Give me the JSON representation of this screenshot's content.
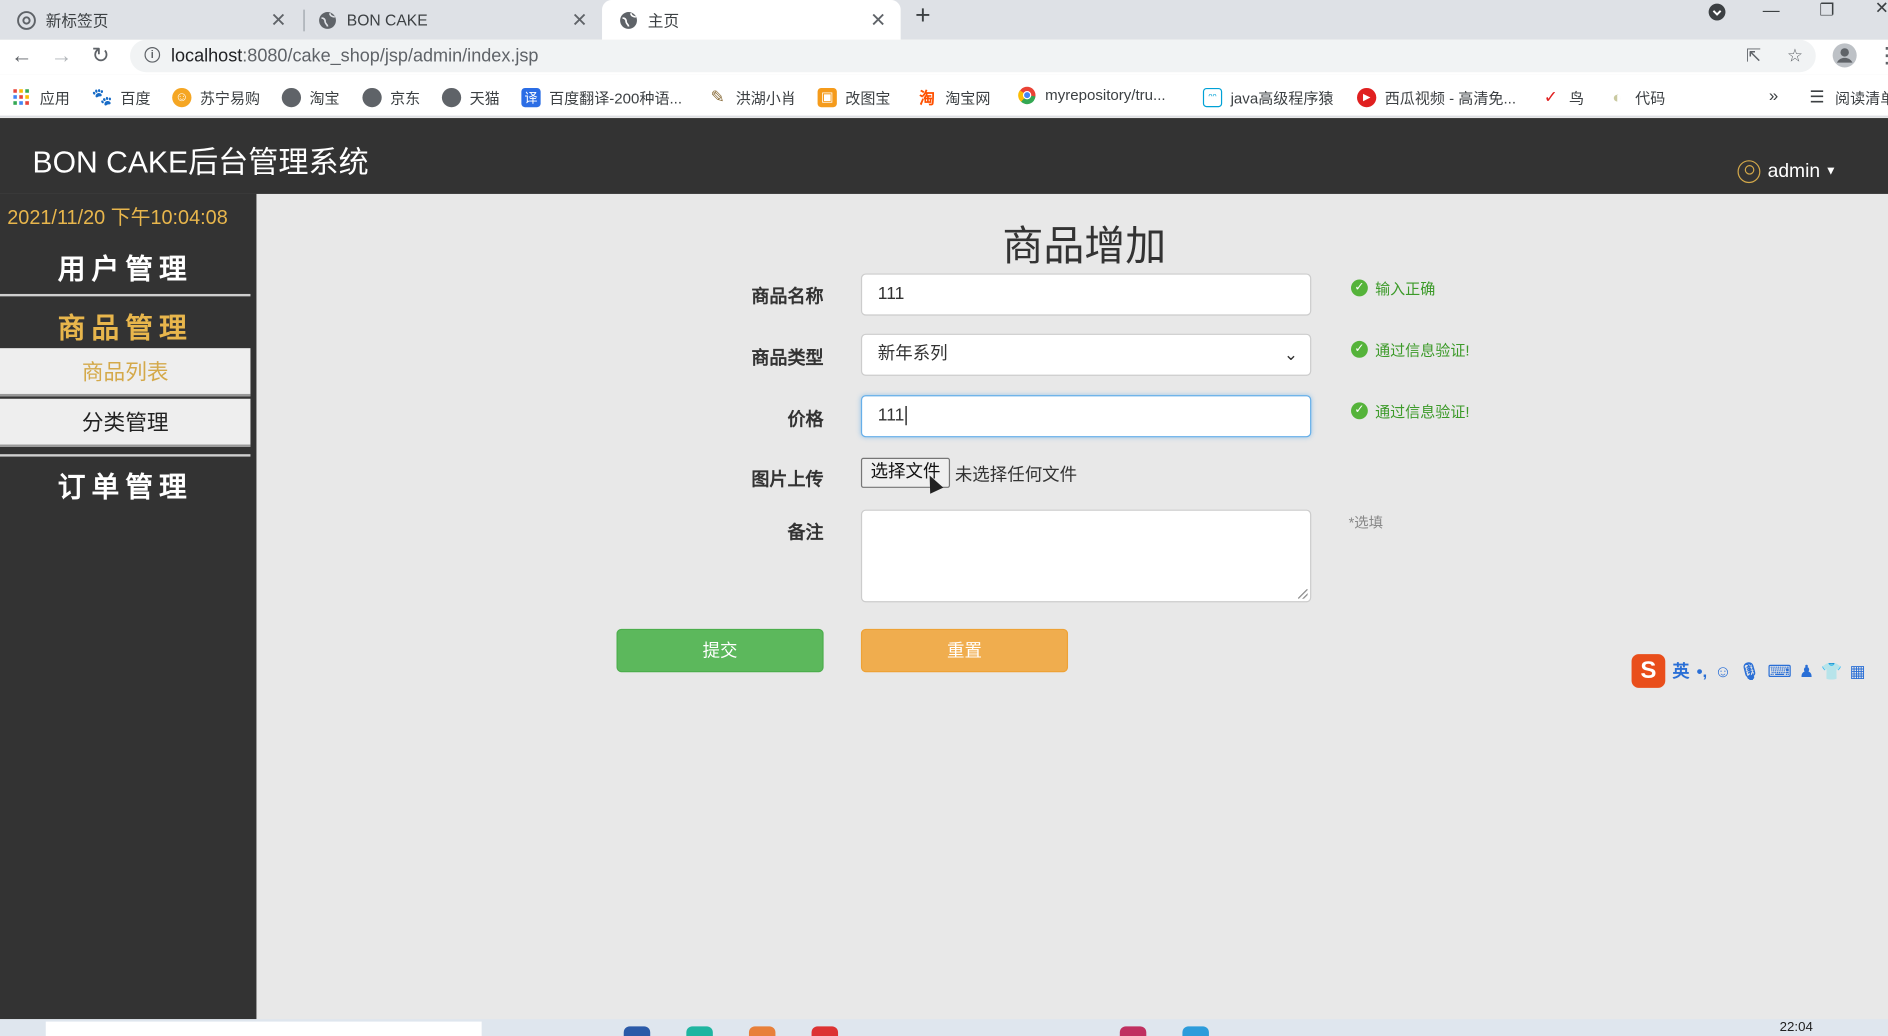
{
  "browser": {
    "tabs": [
      {
        "title": "新标签页",
        "icon": "chrome-icon",
        "active": false
      },
      {
        "title": "BON CAKE",
        "icon": "globe-icon",
        "active": false
      },
      {
        "title": "主页",
        "icon": "globe-icon",
        "active": true
      }
    ],
    "url_host": "localhost",
    "url_path": ":8080/cake_shop/jsp/admin/index.jsp",
    "bookmarks": [
      {
        "label": "应用",
        "icon": "apps-grid-icon",
        "color": "#e8453c"
      },
      {
        "label": "百度",
        "icon": "baidu-paw-icon",
        "color": "#2932e1"
      },
      {
        "label": "苏宁易购",
        "icon": "suning-icon",
        "color": "#f5a623"
      },
      {
        "label": "淘宝",
        "icon": "globe-icon",
        "color": "#5f6368"
      },
      {
        "label": "京东",
        "icon": "globe-icon",
        "color": "#5f6368"
      },
      {
        "label": "天猫",
        "icon": "globe-icon",
        "color": "#5f6368"
      },
      {
        "label": "百度翻译-200种语...",
        "icon": "translate-icon",
        "color": "#2b6de5"
      },
      {
        "label": "洪湖小肖",
        "icon": "feather-icon",
        "color": "#8a6d3b"
      },
      {
        "label": "改图宝",
        "icon": "image-edit-icon",
        "color": "#f59b1b"
      },
      {
        "label": "淘宝网",
        "icon": "taobao-icon",
        "color": "#ff5000"
      },
      {
        "label": "myrepository/tru...",
        "icon": "chrome-icon",
        "color": "#34a853"
      },
      {
        "label": "java高级程序猿",
        "icon": "bilibili-icon",
        "color": "#00a1d6"
      },
      {
        "label": "西瓜视频 - 高清免...",
        "icon": "xigua-icon",
        "color": "#e02020"
      },
      {
        "label": "鸟",
        "icon": "bird-icon",
        "color": "#e02020"
      },
      {
        "label": "代码",
        "icon": "code-icon",
        "color": "#c9c9a0"
      }
    ],
    "reading_list": "阅读清单"
  },
  "app": {
    "brand": "BON CAKE后台管理系统",
    "user": "admin"
  },
  "sidebar": {
    "datetime": "2021/11/20 下午10:04:08",
    "menu_user": "用户管理",
    "menu_goods": "商品管理",
    "sub_goods_list": "商品列表",
    "sub_category": "分类管理",
    "menu_order": "订单管理"
  },
  "form": {
    "title": "商品增加",
    "name_label": "商品名称",
    "name_value": "111",
    "name_status": "输入正确",
    "type_label": "商品类型",
    "type_value": "新年系列",
    "type_status": "通过信息验证!",
    "price_label": "价格",
    "price_value": "111",
    "price_status": "通过信息验证!",
    "image_label": "图片上传",
    "file_button": "选择文件",
    "file_status": "未选择任何文件",
    "note_label": "备注",
    "note_hint": "*选填",
    "submit": "提交",
    "reset": "重置"
  },
  "ime": {
    "mode": "英"
  },
  "taskbar": {
    "time": "22:04"
  },
  "colors": {
    "header_bg": "#333333",
    "accent_gold": "#e8b64c",
    "success_green": "#5cb85c",
    "warning_orange": "#f0ad4e"
  }
}
